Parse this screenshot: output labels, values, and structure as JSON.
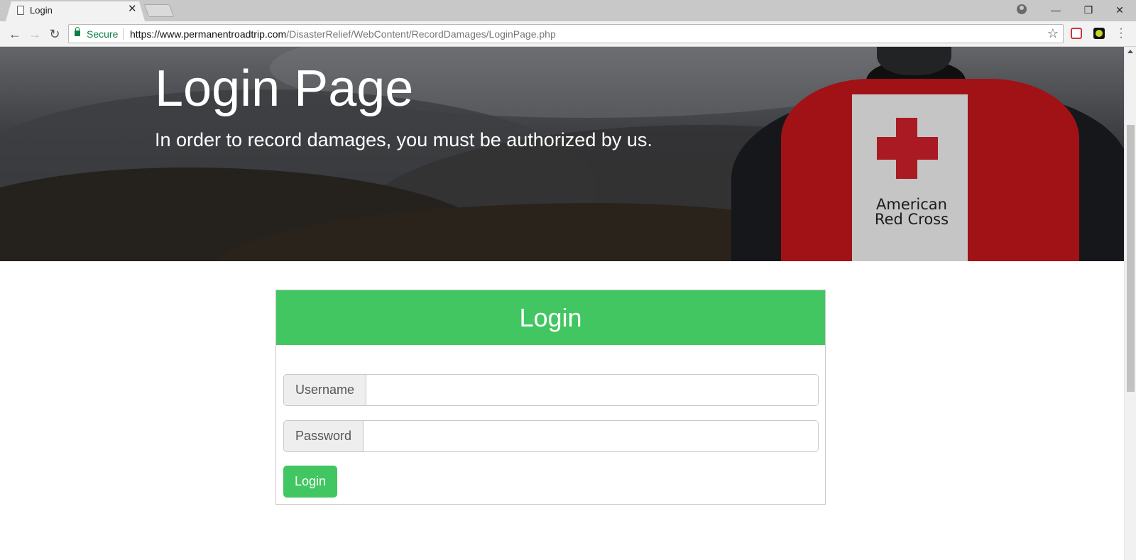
{
  "browser": {
    "tab_title": "Login",
    "secure_label": "Secure",
    "url_host": "https://www.permanentroadtrip.com",
    "url_path": "/DisasterRelief/WebContent/RecordDamages/LoginPage.php"
  },
  "hero": {
    "title": "Login Page",
    "subtitle": "In order to record damages, you must be authorized by us.",
    "image_text": "American Red Cross"
  },
  "login": {
    "heading": "Login",
    "username_label": "Username",
    "username_value": "",
    "password_label": "Password",
    "password_value": "",
    "button_label": "Login"
  },
  "colors": {
    "accent_green": "#42c662",
    "secure_green": "#0b8043",
    "red_cross": "#c4161c"
  }
}
